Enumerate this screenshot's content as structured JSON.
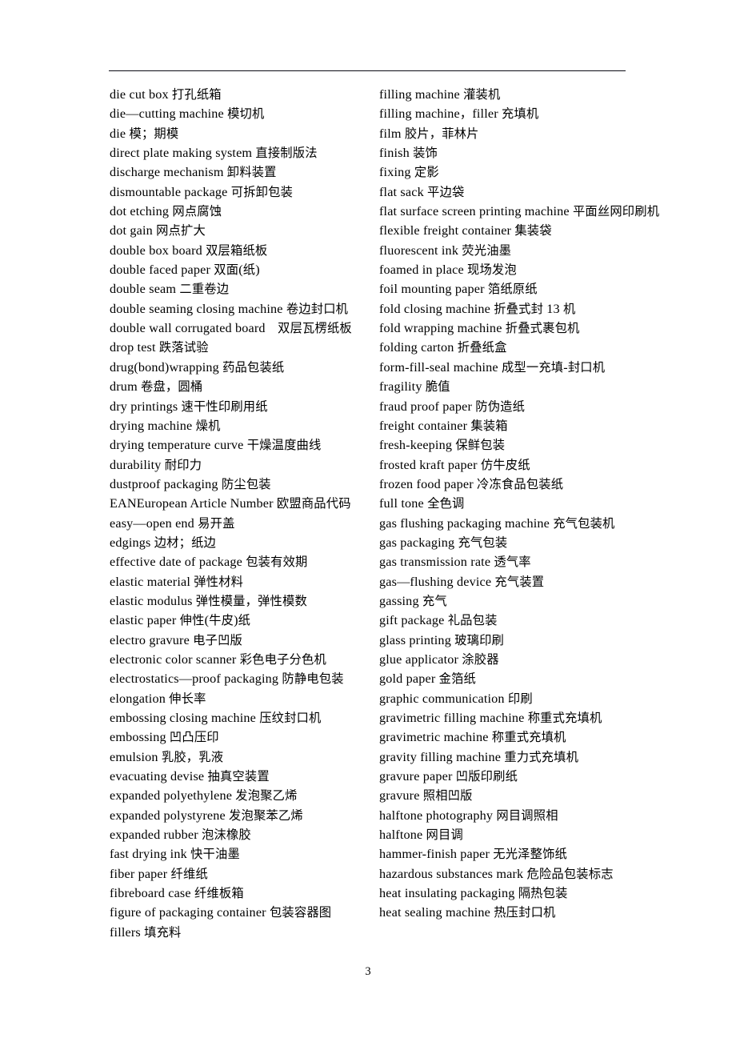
{
  "document": {
    "page_number": "3",
    "header_rule": true,
    "columns": {
      "left": [
        "die cut box 打孔纸箱",
        "die—cutting machine 模切机",
        "die 模；期模",
        "direct plate making system 直接制版法",
        "discharge mechanism 卸料装置",
        "dismountable package 可拆卸包装",
        "dot etching 网点腐蚀",
        "dot gain 网点扩大",
        "double box board 双层箱纸板",
        "double faced paper 双面(纸)",
        "double seam 二重卷边",
        "double seaming closing machine 卷边封口机",
        "double wall corrugated board　双层瓦楞纸板",
        "drop test 跌落试验",
        "drug(bond)wrapping 药品包装纸",
        "drum 卷盘，圆桶",
        "dry printings 速干性印刷用纸",
        "drying machine 燥机",
        "drying temperature curve 干燥温度曲线",
        "durability 耐印力",
        "dustproof packaging 防尘包装",
        "EANEuropean Article Number 欧盟商品代码",
        "easy—open end 易开盖",
        "edgings 边材；纸边",
        "effective date of package 包装有效期",
        "elastic material 弹性材料",
        "elastic modulus 弹性模量，弹性模数",
        "elastic paper 伸性(牛皮)纸",
        "electro gravure 电子凹版",
        "electronic color scanner 彩色电子分色机",
        "electrostatics—proof packaging 防静电包装",
        "elongation 伸长率",
        "embossing closing machine 压纹封口机",
        "embossing 凹凸压印",
        "emulsion 乳胶，乳液",
        "evacuating devise 抽真空装置",
        "expanded polyethylene 发泡聚乙烯",
        "expanded polystyrene 发泡聚苯乙烯",
        "expanded rubber 泡沫橡胶",
        "fast drying ink 快干油墨",
        "fiber paper 纤维纸",
        "fibreboard case 纤维板箱",
        "figure of packaging container 包装容器图",
        "fillers 填充料"
      ],
      "right": [
        "filling machine 灌装机",
        "filling machine，filler 充填机",
        "film 胶片，菲林片",
        "finish 装饰",
        "fixing 定影",
        "flat sack 平边袋",
        "flat surface screen printing machine 平面丝网印刷机",
        "flexible freight container 集装袋",
        "fluorescent ink 荧光油墨",
        "foamed in place 现场发泡",
        "foil mounting paper 箔纸原纸",
        "fold closing machine 折叠式封 13 机",
        "fold wrapping machine 折叠式裹包机",
        "folding carton 折叠纸盒",
        "form-fill-seal machine 成型一充填-封口机",
        "fragility 脆值",
        "fraud proof paper 防伪造纸",
        "freight container 集装箱",
        "fresh-keeping 保鲜包装",
        "frosted kraft paper 仿牛皮纸",
        "frozen food paper 冷冻食品包装纸",
        "full tone 全色调",
        "gas flushing packaging machine 充气包装机",
        "gas packaging 充气包装",
        "gas transmission rate 透气率",
        "gas—flushing device 充气装置",
        "gassing 充气",
        "gift package 礼品包装",
        "glass printing 玻璃印刷",
        "glue applicator 涂胶器",
        "gold paper 金箔纸",
        "graphic communication 印刷",
        "gravimetric filling machine 称重式充填机",
        "gravimetric machine 称重式充填机",
        "gravity filling machine 重力式充填机",
        "gravure paper 凹版印刷纸",
        "gravure 照相凹版",
        "halftone photography 网目调照相",
        "halftone 网目调",
        "hammer-finish paper 无光泽整饰纸",
        "hazardous substances mark 危险品包装标志",
        "heat insulating packaging 隔热包装",
        "heat sealing machine 热压封口机"
      ]
    }
  }
}
